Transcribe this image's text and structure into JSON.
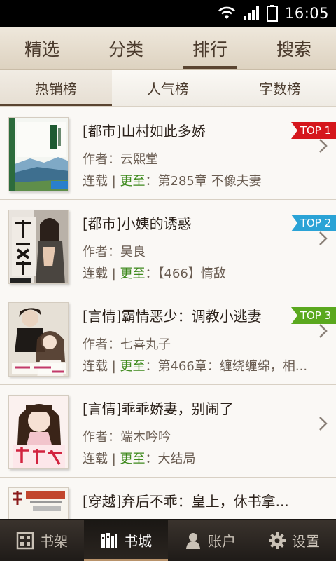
{
  "status_bar": {
    "time": "16:05"
  },
  "top_tabs": [
    {
      "label": "精选",
      "active": false
    },
    {
      "label": "分类",
      "active": false
    },
    {
      "label": "排行",
      "active": true
    },
    {
      "label": "搜索",
      "active": false
    }
  ],
  "sub_tabs": [
    {
      "label": "热销榜",
      "active": true
    },
    {
      "label": "人气榜",
      "active": false
    },
    {
      "label": "字数榜",
      "active": false
    }
  ],
  "books": [
    {
      "title": "[都市]山村如此多娇",
      "author": "作者：云熙堂",
      "status": "连载 | ",
      "upto": "更至",
      "chapter": "：第285章 不像夫妻",
      "rank": "TOP 1"
    },
    {
      "title": "[都市]小姨的诱惑",
      "author": "作者：吴良",
      "status": "连载 | ",
      "upto": "更至",
      "chapter": "：【466】情敌",
      "rank": "TOP 2"
    },
    {
      "title": "[言情]霸情恶少：调教小逃妻",
      "author": "作者：七喜丸子",
      "status": "连载 | ",
      "upto": "更至",
      "chapter": "：第466章：缠绕缠绵，相...",
      "rank": "TOP 3"
    },
    {
      "title": "[言情]乖乖娇妻，别闹了",
      "author": "作者：端木吟吟",
      "status": "连载 | ",
      "upto": "更至",
      "chapter": "：大结局",
      "rank": ""
    },
    {
      "title": "[穿越]弃后不乖：皇上，休书拿...",
      "author": "",
      "status": "",
      "upto": "",
      "chapter": "",
      "rank": ""
    }
  ],
  "bottom_nav": [
    {
      "label": "书架",
      "icon": "bookshelf-icon",
      "active": false
    },
    {
      "label": "书城",
      "icon": "bookstore-icon",
      "active": true
    },
    {
      "label": "账户",
      "icon": "account-icon",
      "active": false
    },
    {
      "label": "设置",
      "icon": "settings-gear-icon",
      "active": false
    }
  ],
  "colors": {
    "rank1": "#d5161c",
    "rank2": "#2aa3d6",
    "rank3": "#5aa81e",
    "update_highlight": "#3f8a1e"
  }
}
